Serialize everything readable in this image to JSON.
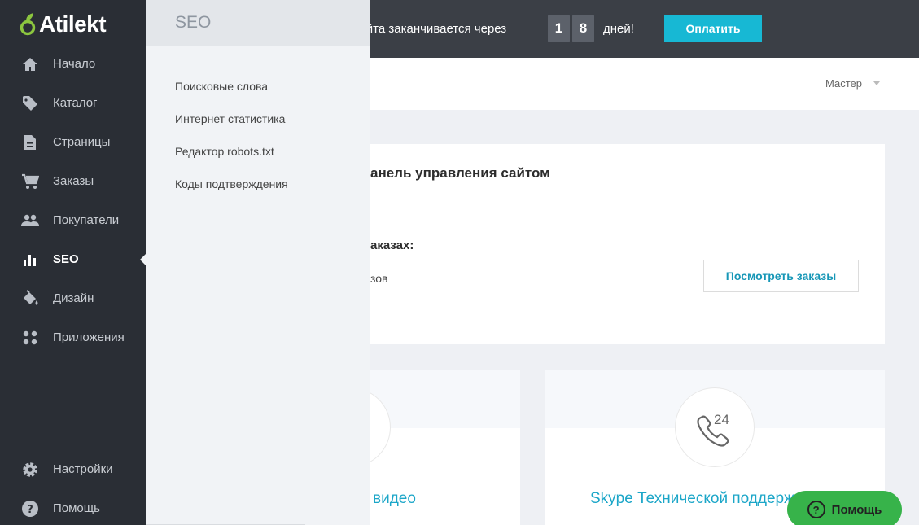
{
  "brand": {
    "name": "Atilekt"
  },
  "topbar": {
    "trial_text": "ы сайта заканчивается через",
    "days_digits": [
      "1",
      "8"
    ],
    "days_label": "дней!",
    "pay_button": "Оплатить"
  },
  "subbar": {
    "role_label": "Мастер"
  },
  "sidebar": {
    "items": [
      {
        "label": "Начало",
        "icon": "home-icon"
      },
      {
        "label": "Каталог",
        "icon": "tag-icon"
      },
      {
        "label": "Страницы",
        "icon": "page-icon"
      },
      {
        "label": "Заказы",
        "icon": "cart-icon"
      },
      {
        "label": "Покупатели",
        "icon": "users-icon"
      },
      {
        "label": "SEO",
        "icon": "bar-chart-icon",
        "active": true
      },
      {
        "label": "Дизайн",
        "icon": "paint-bucket-icon"
      },
      {
        "label": "Приложения",
        "icon": "apps-icon"
      }
    ],
    "bottom_items": [
      {
        "label": "Настройки",
        "icon": "gear-icon"
      },
      {
        "label": "Помощь",
        "icon": "help-icon"
      }
    ]
  },
  "flyout": {
    "title": "SEO",
    "items": [
      "Поисковые слова",
      "Интернет статистика",
      "Редактор robots.txt",
      "Коды подтверждения"
    ]
  },
  "main": {
    "card_title": "анель управления сайтом",
    "orders_heading": "аказах:",
    "orders_text": "зов",
    "view_orders_button": "Посмотреть заказы",
    "video_title": "видео",
    "skype_title": "Skype Технической поддержк",
    "skype_badge": "24"
  },
  "help_button": {
    "label": "Помощь"
  },
  "colors": {
    "accent": "#17b8d4",
    "sidebar": "#2a2e35",
    "topbar": "#3b3f46",
    "help": "#37b34a",
    "link": "#1ba6c8"
  }
}
